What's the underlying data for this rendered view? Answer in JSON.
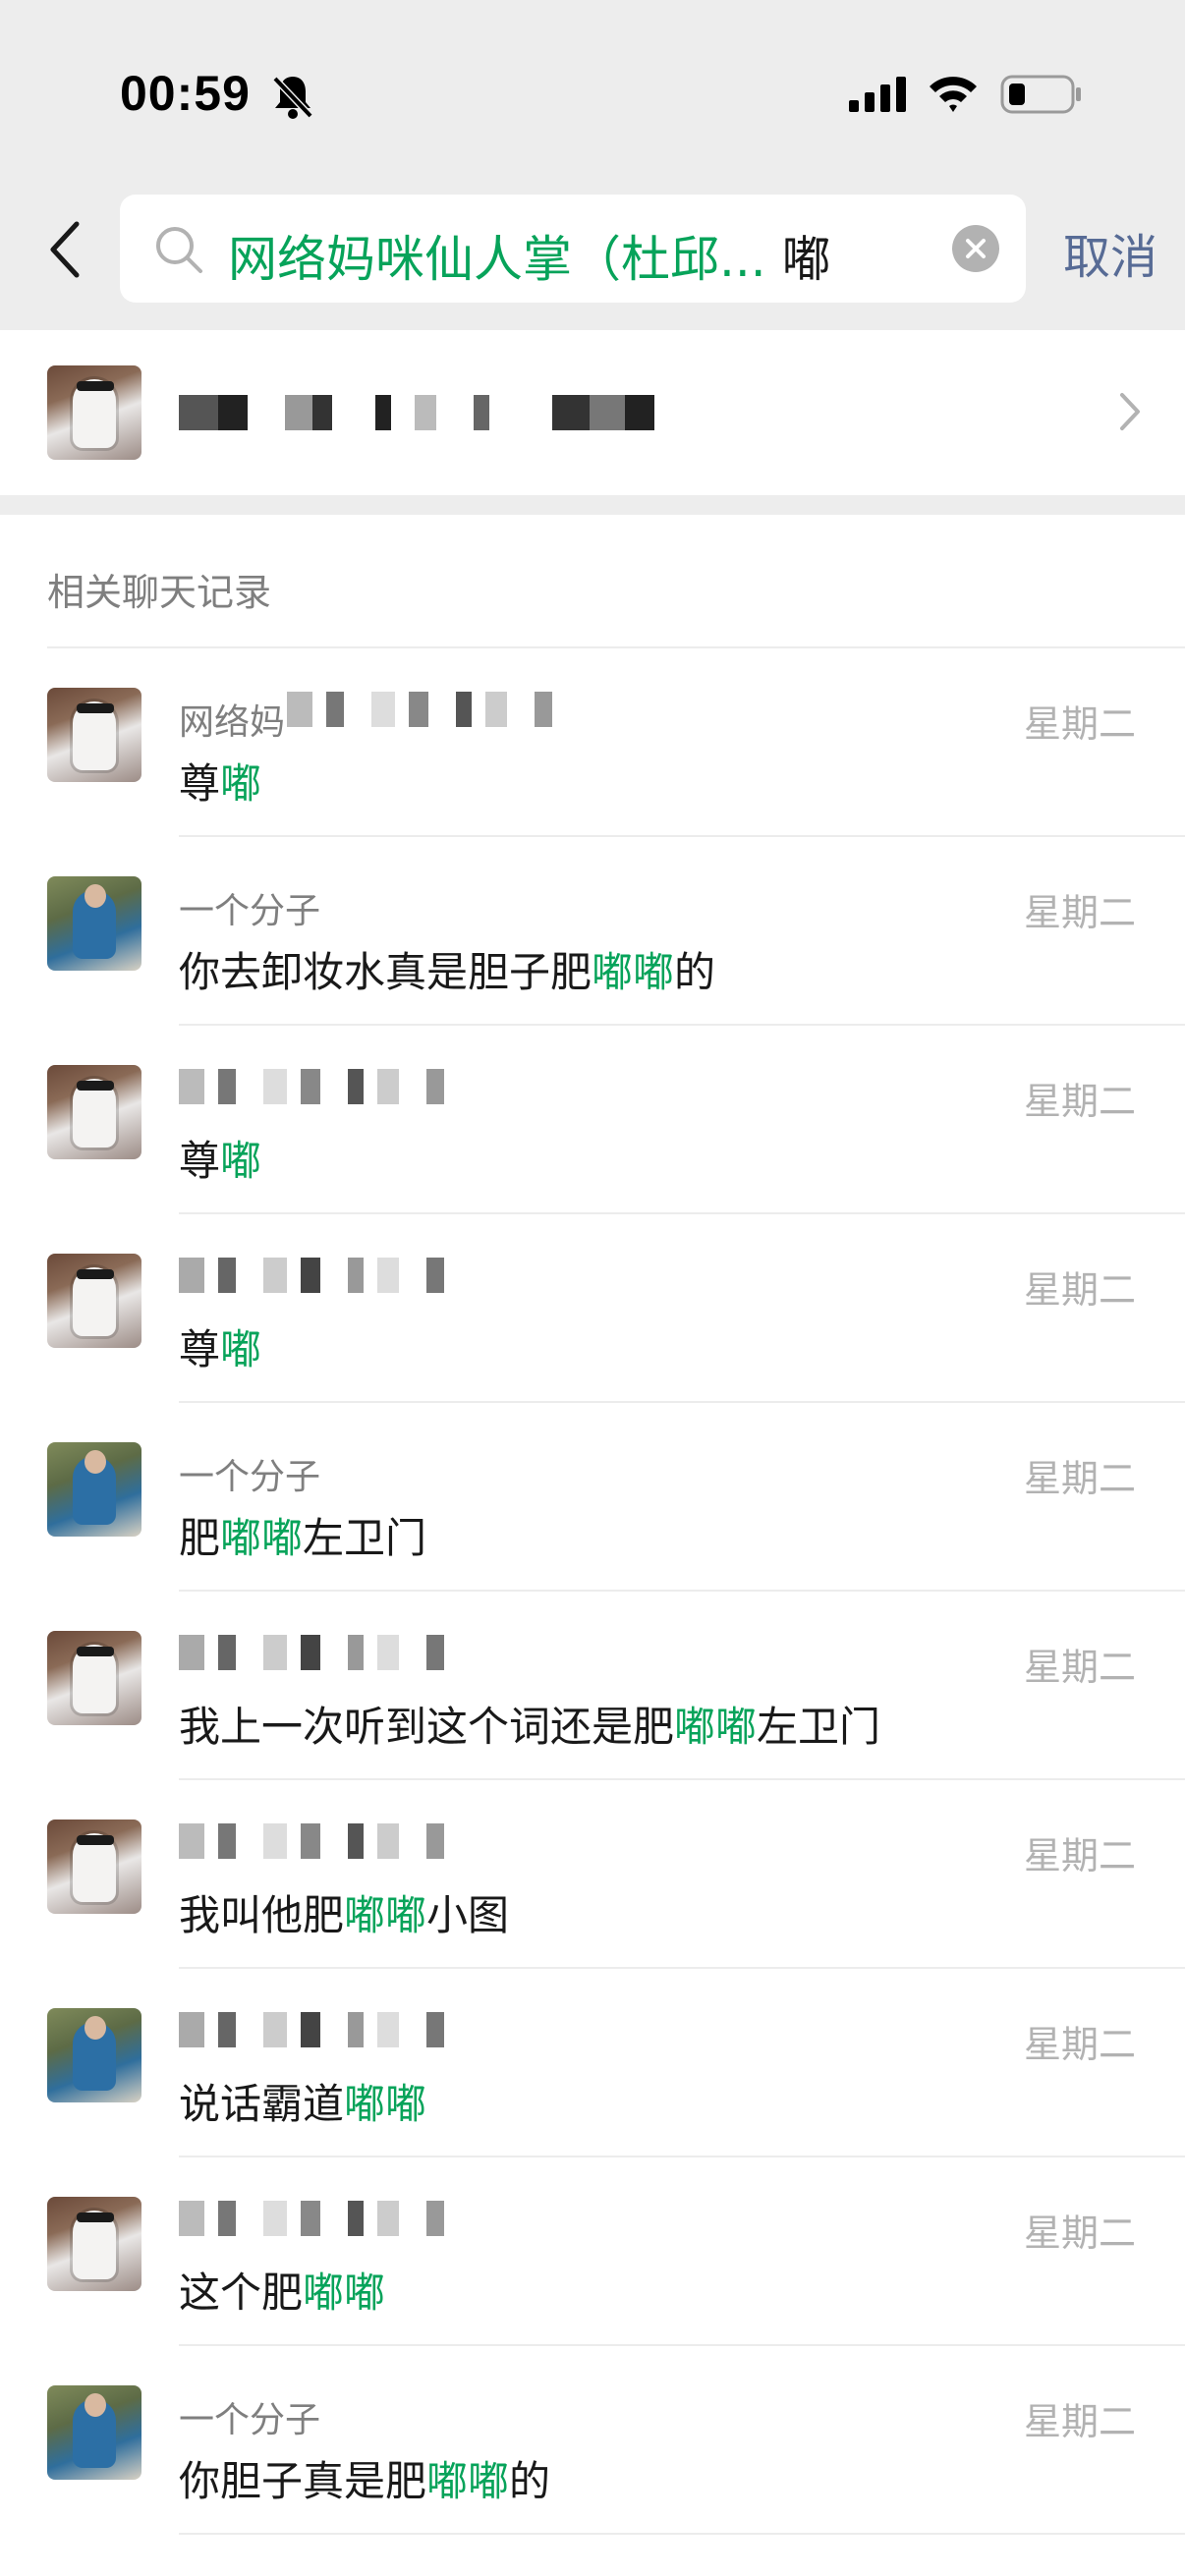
{
  "status_bar": {
    "time": "00:59"
  },
  "search": {
    "query_highlight": "网络妈咪仙人掌（杜邱...",
    "query_rest": " 嘟",
    "cancel_label": "取消"
  },
  "section": {
    "title": "相关聊天记录"
  },
  "results": [
    {
      "avatar": "a",
      "name": "网络妈",
      "date": "星期二",
      "pre": "尊",
      "hl": "嘟",
      "post": ""
    },
    {
      "avatar": "b",
      "name": "一个分子",
      "date": "星期二",
      "pre": "你去卸妆水真是胆子肥",
      "hl": "嘟嘟",
      "post": "的"
    },
    {
      "avatar": "a",
      "name": "",
      "date": "星期二",
      "pre": "尊",
      "hl": "嘟",
      "post": ""
    },
    {
      "avatar": "a",
      "name": "",
      "date": "星期二",
      "pre": "尊",
      "hl": "嘟",
      "post": ""
    },
    {
      "avatar": "b",
      "name": "一个分子",
      "date": "星期二",
      "pre": "肥",
      "hl": "嘟嘟",
      "post": "左卫门"
    },
    {
      "avatar": "a",
      "name": "",
      "date": "星期二",
      "pre": "我上一次听到这个词还是肥",
      "hl": "嘟嘟",
      "post": "左卫门"
    },
    {
      "avatar": "a",
      "name": "",
      "date": "星期二",
      "pre": "我叫他肥",
      "hl": "嘟嘟",
      "post": "小图"
    },
    {
      "avatar": "b",
      "name": "",
      "date": "星期二",
      "pre": "说话霸道",
      "hl": "嘟嘟",
      "post": ""
    },
    {
      "avatar": "a",
      "name": "",
      "date": "星期二",
      "pre": "这个肥",
      "hl": "嘟嘟",
      "post": ""
    },
    {
      "avatar": "b",
      "name": "一个分子",
      "date": "星期二",
      "pre": "你胆子真是肥",
      "hl": "嘟嘟",
      "post": "的"
    }
  ]
}
